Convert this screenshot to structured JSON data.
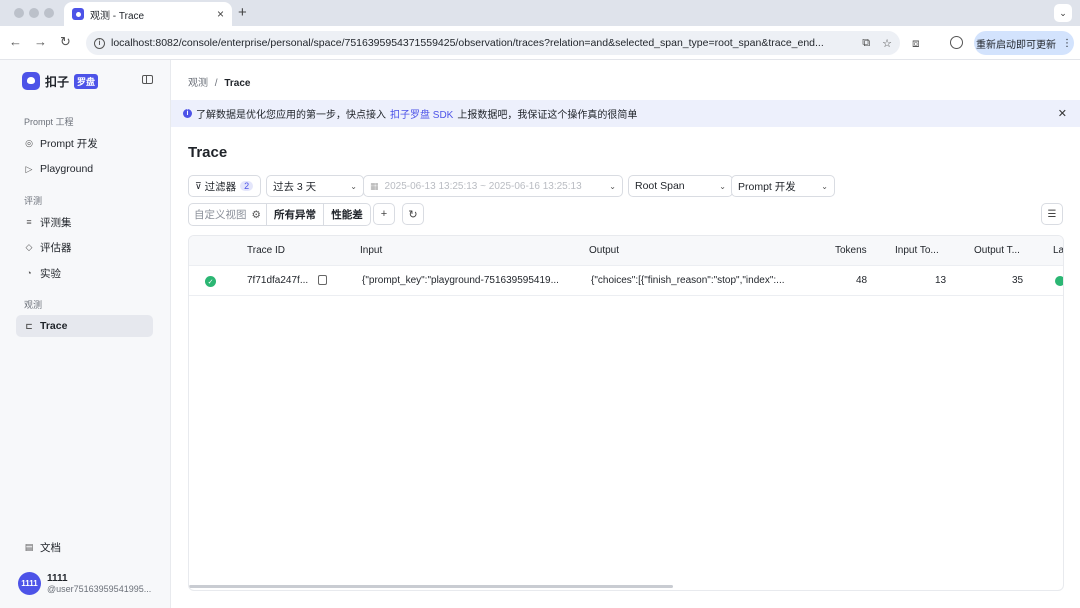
{
  "browser": {
    "tab_title": "观测 - Trace",
    "url": "localhost:8082/console/enterprise/personal/space/7516395954371559425/observation/traces?relation=and&selected_span_type=root_span&trace_end...",
    "update_label": "重新启动即可更新"
  },
  "sidebar": {
    "brand": "扣子",
    "brand_badge": "罗盘",
    "groups": [
      {
        "title": "Prompt 工程",
        "items": [
          {
            "label": "Prompt 开发"
          },
          {
            "label": "Playground"
          }
        ]
      },
      {
        "title": "评测",
        "items": [
          {
            "label": "评测集"
          },
          {
            "label": "评估器"
          },
          {
            "label": "实验"
          }
        ]
      },
      {
        "title": "观测",
        "items": [
          {
            "label": "Trace"
          }
        ]
      }
    ],
    "docs_label": "文档",
    "user": {
      "avatar": "1111",
      "name": "1111",
      "handle": "@user75163959541995..."
    }
  },
  "main": {
    "breadcrumb": {
      "parent": "观测",
      "sep": "/",
      "current": "Trace"
    },
    "banner": {
      "text_before": "了解数据是优化您应用的第一步，快点接入",
      "link": "扣子罗盘 SDK",
      "text_after": "上报数据吧，我保证这个操作真的很简单"
    },
    "title": "Trace",
    "filters": {
      "filter_label": "过滤器",
      "filter_count": "2",
      "time_range": "过去 3 天",
      "date_range": "2025-06-13 13:25:13 ~ 2025-06-16 13:25:13",
      "span_type": "Root Span",
      "platform": "Prompt 开发"
    },
    "views": {
      "custom": "自定义视图",
      "all_errors": "所有异常",
      "poor_perf": "性能差",
      "add": "+"
    },
    "table": {
      "columns": [
        "Trace ID",
        "Input",
        "Output",
        "Tokens",
        "Input To...",
        "Output T...",
        "La"
      ],
      "rows": [
        {
          "trace_id": "7f71dfa247f...",
          "input": "{\"prompt_key\":\"playground-751639595419...",
          "output": "{\"choices\":[{\"finish_reason\":\"stop\",\"index\":...",
          "tokens": "48",
          "input_tokens": "13",
          "output_tokens": "35"
        }
      ]
    }
  },
  "colors": {
    "accent": "#4d53e8",
    "success": "#2bb673"
  }
}
